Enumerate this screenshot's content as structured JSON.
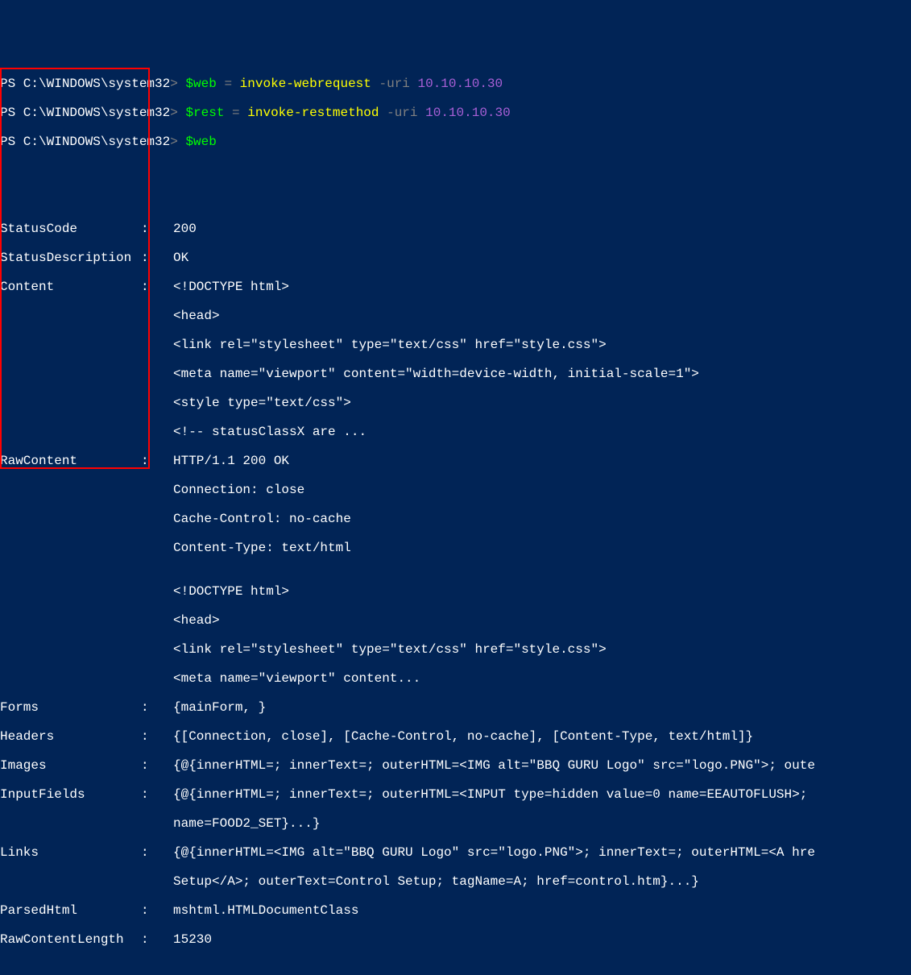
{
  "lines": {
    "l1_prompt": "PS C:\\WINDOWS\\system32",
    "l1_gt": "> ",
    "l1_var": "$web",
    "l1_eq": " = ",
    "l1_cmd": "invoke-webrequest",
    "l1_param": " -uri ",
    "l1_arg": "10.10.10.30",
    "l2_prompt": "PS C:\\WINDOWS\\system32",
    "l2_gt": "> ",
    "l2_var": "$rest",
    "l2_eq": " = ",
    "l2_cmd": "invoke-restmethod",
    "l2_param": " -uri ",
    "l2_arg": "10.10.10.30",
    "l3_prompt": "PS C:\\WINDOWS\\system32",
    "l3_gt": "> ",
    "l3_var": "$web"
  },
  "fields": {
    "statuscode_label": "StatusCode",
    "statuscode_value": "200",
    "statusdesc_label": "StatusDescription",
    "statusdesc_value": "OK",
    "content_label": "Content",
    "content_v1": "<!DOCTYPE html>",
    "content_v2": "<head>",
    "content_v3": "<link rel=\"stylesheet\" type=\"text/css\" href=\"style.css\">",
    "content_v4": "<meta name=\"viewport\" content=\"width=device-width, initial-scale=1\">",
    "content_v5": "<style type=\"text/css\">",
    "content_v6": "<!-- statusClassX are ...",
    "rawcontent_label": "RawContent",
    "rawcontent_v1": "HTTP/1.1 200 OK",
    "rawcontent_v2": "Connection: close",
    "rawcontent_v3": "Cache-Control: no-cache",
    "rawcontent_v4": "Content-Type: text/html",
    "rawcontent_v5": "",
    "rawcontent_v6": "<!DOCTYPE html>",
    "rawcontent_v7": "<head>",
    "rawcontent_v8": "<link rel=\"stylesheet\" type=\"text/css\" href=\"style.css\">",
    "rawcontent_v9": "<meta name=\"viewport\" content...",
    "forms_label": "Forms",
    "forms_value": "{mainForm, }",
    "headers_label": "Headers",
    "headers_value": "{[Connection, close], [Cache-Control, no-cache], [Content-Type, text/html]}",
    "images_label": "Images",
    "images_value": "{@{innerHTML=; innerText=; outerHTML=<IMG alt=\"BBQ GURU Logo\" src=\"logo.PNG\">; oute",
    "inputfields_label": "InputFields",
    "inputfields_v1": "{@{innerHTML=; innerText=; outerHTML=<INPUT type=hidden value=0 name=EEAUTOFLUSH>;",
    "inputfields_v2": "name=FOOD2_SET}...}",
    "links_label": "Links",
    "links_v1": "{@{innerHTML=<IMG alt=\"BBQ GURU Logo\" src=\"logo.PNG\">; innerText=; outerHTML=<A hre",
    "links_v2": "Setup</A>; outerText=Control Setup; tagName=A; href=control.htm}...}",
    "parsedhtml_label": "ParsedHtml",
    "parsedhtml_value": "mshtml.HTMLDocumentClass",
    "rawcontentlength_label": "RawContentLength",
    "rawcontentlength_value": "15230"
  },
  "colon": ":"
}
